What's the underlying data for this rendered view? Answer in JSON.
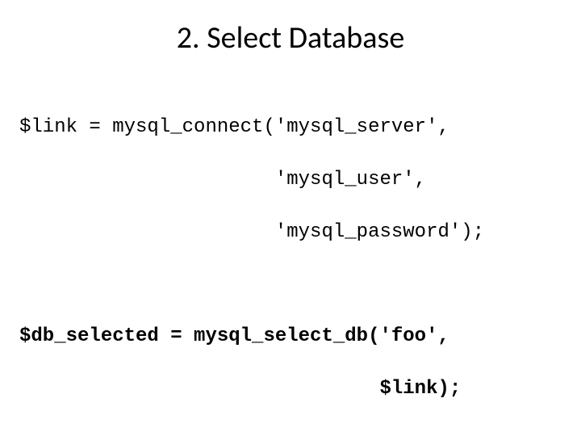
{
  "title": "2. Select Database",
  "code": {
    "l1": "$link = mysql_connect('mysql_server',",
    "l2": "                      'mysql_user',",
    "l3": "                      'mysql_password');",
    "l4": "$db_selected = mysql_select_db('foo',",
    "l5": "                               $link);"
  }
}
